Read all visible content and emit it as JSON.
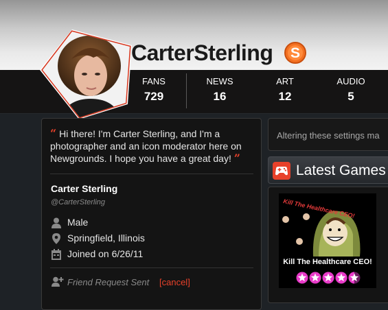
{
  "header": {
    "username": "CarterSterling"
  },
  "stats": [
    {
      "label": "FANS",
      "value": "729"
    },
    {
      "label": "NEWS",
      "value": "16"
    },
    {
      "label": "ART",
      "value": "12"
    },
    {
      "label": "AUDIO",
      "value": "5"
    }
  ],
  "profile": {
    "bio": "Hi there! I'm Carter Sterling, and I'm a photographer and an icon moderator here on Newgrounds. I hope you have a great day!",
    "real_name": "Carter Sterling",
    "handle": "@CarterSterling",
    "gender": "Male",
    "location": "Springfield, Illinois",
    "joined": "Joined on 6/26/11",
    "friend_status": "Friend Request Sent",
    "cancel_label": "[cancel]"
  },
  "settings_notice": "Altering these settings ma",
  "latest_games": {
    "title": "Latest Games",
    "items": [
      {
        "title": "Kill The Healthcare CEO!",
        "thumb_text": "Kill The Healthcare CEO!",
        "rating_stars": 4.5,
        "rating_max": 5
      }
    ]
  },
  "colors": {
    "accent_red": "#e8412a",
    "supporter_orange": "#f37021",
    "star_pink": "#e83ac8",
    "background": "#1e2226"
  },
  "icons": [
    "supporter-badge-icon",
    "user-icon",
    "location-pin-icon",
    "calendar-icon",
    "add-friend-icon",
    "gamepad-icon",
    "star-icon"
  ]
}
